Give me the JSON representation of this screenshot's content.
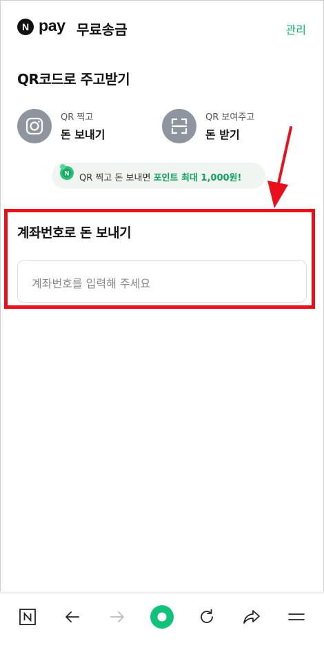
{
  "header": {
    "logo_letter": "N",
    "logo_text": "pay",
    "title": "무료송금",
    "manage_label": "관리"
  },
  "qr": {
    "section_title": "QR코드로 주고받기",
    "send": {
      "small": "QR 찍고",
      "big": "돈 보내기",
      "icon": "camera-icon"
    },
    "receive": {
      "small": "QR 보여주고",
      "big": "돈 받기",
      "icon": "scan-frame-icon"
    }
  },
  "promo": {
    "text_prefix": "QR 찍고 돈 보내면 ",
    "text_highlight": "포인트 최대 1,000원!"
  },
  "account": {
    "title": "계좌번호로 돈 보내기",
    "placeholder": "계좌번호를 입력해 주세요"
  },
  "bottom_nav": {
    "icons": [
      "n-home-icon",
      "back-arrow-icon",
      "forward-arrow-icon",
      "center-dot-icon",
      "refresh-icon",
      "share-icon",
      "menu-icon"
    ]
  },
  "colors": {
    "accent": "#12b36a",
    "highlight_border": "#e8101a",
    "icon_circle": "#8f959e"
  }
}
